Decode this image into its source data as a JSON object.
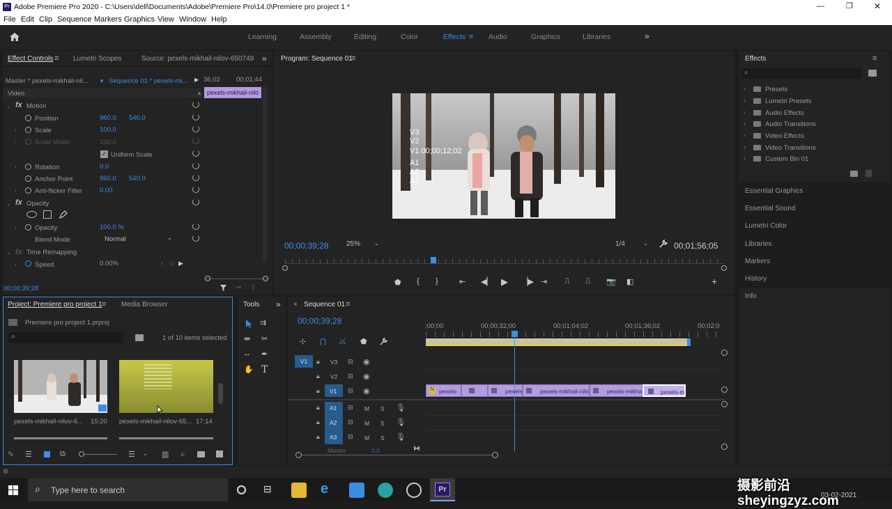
{
  "title_bar": {
    "title": "Adobe Premiere Pro 2020 - C:\\Users\\dell\\Documents\\Adobe\\Premiere Pro\\14.0\\Premiere pro project 1 *",
    "app_icon": "Pr",
    "minimize": "—",
    "restore": "❐",
    "close": "✕"
  },
  "menu": [
    "File",
    "Edit",
    "Clip",
    "Sequence",
    "Markers",
    "Graphics",
    "View",
    "Window",
    "Help"
  ],
  "workspaces": [
    "Learning",
    "Assembly",
    "Editing",
    "Color",
    "Effects",
    "Audio",
    "Graphics",
    "Libraries"
  ],
  "workspace_active": "Effects",
  "workspace_more": "»",
  "effect_controls": {
    "tabs": [
      "Effect Controls",
      "Lumetri Scopes",
      "Source: pexels-mikhail-nilov-650749"
    ],
    "master": "Master * pexels-mikhail-nil...",
    "sequence": "Sequence 01 * pexels-mi...",
    "time_left": "36;02",
    "time_right": "00;01;44",
    "clip_label": "pexels-mikhail-nilo",
    "video_label": "Video",
    "motion": "Motion",
    "position_label": "Position",
    "position_x": "960.0",
    "position_y": "540.0",
    "scale_label": "Scale",
    "scale_val": "100.0",
    "scale_width_label": "Scale Width",
    "scale_width_val": "100.0",
    "uniform_scale": "Uniform Scale",
    "rotation_label": "Rotation",
    "rotation_val": "0.0",
    "anchor_label": "Anchor Point",
    "anchor_x": "960.0",
    "anchor_y": "540.0",
    "antiflicker_label": "Anti-flicker Filter",
    "antiflicker_val": "0.00",
    "opacity_group": "Opacity",
    "opacity_label": "Opacity",
    "opacity_val": "100.0 %",
    "blend_label": "Blend Mode",
    "blend_val": "Normal",
    "time_remap": "Time Remapping",
    "speed_label": "Speed",
    "speed_val": "0.00%",
    "timecode": "00;00;39;28"
  },
  "program": {
    "title": "Program: Sequence 01",
    "overlay": [
      "V3",
      "V2",
      "V1 00;00;12;02",
      "A1",
      "A2",
      "A3"
    ],
    "timecode": "00;00;39;28",
    "zoom": "25%",
    "quality": "1/4",
    "duration": "00;01;56;05"
  },
  "project": {
    "tabs": [
      "Project: Premiere pro project 1",
      "Media Browser"
    ],
    "file": "Premiere pro project 1.prproj",
    "selection": "1 of 10 items selected",
    "items": [
      {
        "name": "pexels-mikhail-nilov-6...",
        "duration": "15:20"
      },
      {
        "name": "pexels-mikhail-nilov-65...",
        "duration": "17:14"
      }
    ]
  },
  "tools": {
    "title": "Tools"
  },
  "timeline": {
    "title": "Sequence 01",
    "timecode": "00;00;39;28",
    "ruler": [
      ";00;00",
      "00;00;32;00",
      "00;01;04;02",
      "00;01;36;02",
      "00;02;0"
    ],
    "video_tracks": [
      "V3",
      "V2",
      "V1"
    ],
    "audio_tracks": [
      "A1",
      "A2",
      "A3"
    ],
    "master": "Master",
    "master_val": "0.0",
    "clips": [
      "pexels-",
      "",
      "pexels-",
      "pexels-mikhail-nilov",
      "pexels-mikhai",
      "pexels-mi"
    ],
    "m": "M",
    "s": "S"
  },
  "effects_panel": {
    "title": "Effects",
    "folders": [
      "Presets",
      "Lumetri Presets",
      "Audio Effects",
      "Audio Transitions",
      "Video Effects",
      "Video Transitions",
      "Custom Bin 01"
    ]
  },
  "right_panels": [
    "Essential Graphics",
    "Essential Sound",
    "Lumetri Color",
    "Libraries",
    "Markers",
    "History",
    "Info"
  ],
  "taskbar": {
    "search": "Type here to search",
    "date": "03-02-2021"
  },
  "watermark": "摄影前沿 sheyingzyz.com",
  "colors": {
    "accent": "#3d8ee8",
    "clip": "#b49ae0",
    "bg": "#232323"
  }
}
